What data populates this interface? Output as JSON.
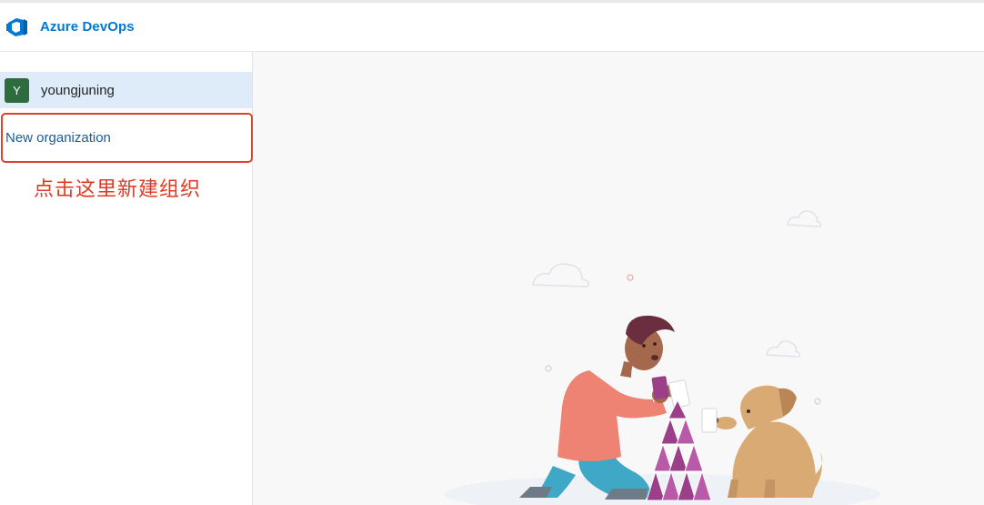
{
  "header": {
    "brand_title": "Azure DevOps",
    "logo_icon": "azure-devops-logo-icon",
    "accent": "#0078d4"
  },
  "sidebar": {
    "organizations": [
      {
        "avatar_letter": "Y",
        "name": "youngjuning",
        "avatar_color": "#2e6b3e",
        "selected": true
      }
    ],
    "new_org_label": "New organization"
  },
  "annotation": {
    "text": "点击这里新建组织",
    "color": "#e03a24"
  },
  "main": {
    "illustration": "person-building-card-house-with-dog-illustration"
  }
}
